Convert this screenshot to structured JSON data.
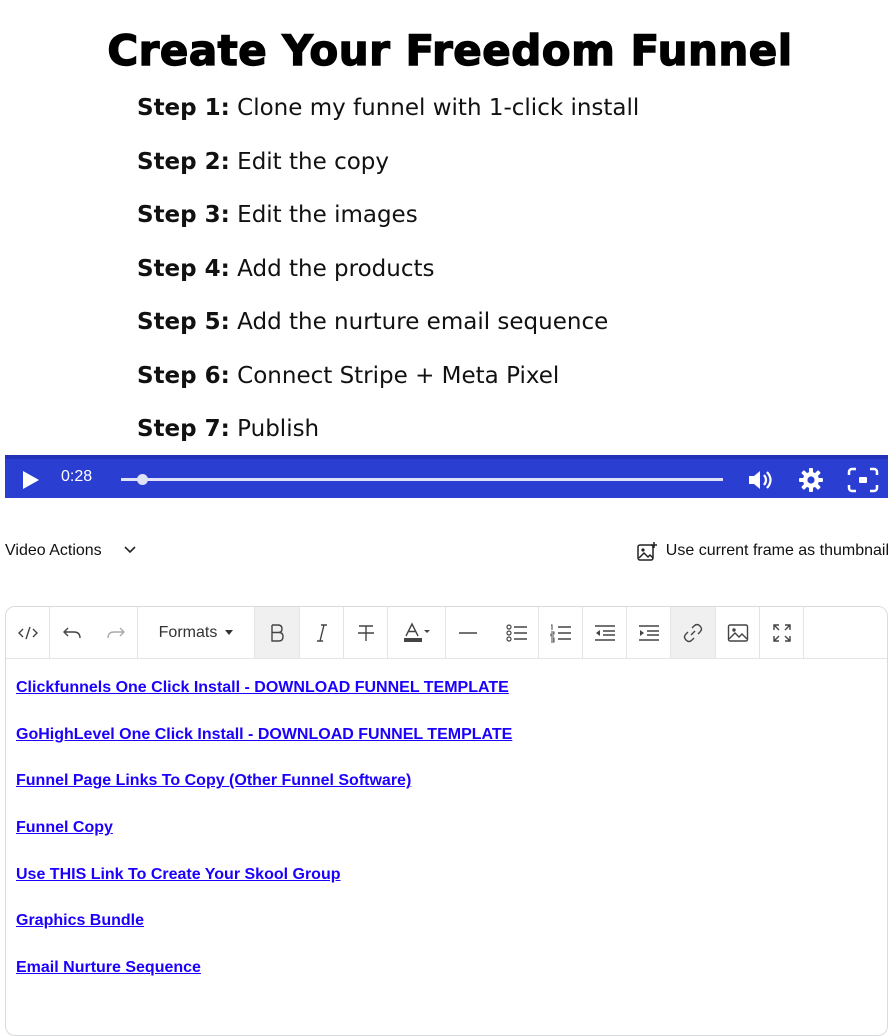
{
  "slide": {
    "title": "Create Your Freedom Funnel",
    "steps": [
      {
        "label": "Step 1:",
        "text": "Clone my funnel with 1-click install"
      },
      {
        "label": "Step 2:",
        "text": "Edit the copy"
      },
      {
        "label": "Step 3:",
        "text": "Edit the images"
      },
      {
        "label": "Step 4:",
        "text": "Add the products"
      },
      {
        "label": "Step 5:",
        "text": "Add the nurture email sequence"
      },
      {
        "label": "Step 6:",
        "text": "Connect Stripe + Meta Pixel"
      },
      {
        "label": "Step 7:",
        "text": "Publish"
      }
    ]
  },
  "player": {
    "time": "0:28",
    "progress": 0.035,
    "colors": {
      "bar": "#2a3fd2",
      "icon": "#ffffff"
    },
    "icons": [
      "play-icon",
      "volume-icon",
      "settings-gear-icon",
      "fullscreen-icon"
    ]
  },
  "actions": {
    "video_actions_label": "Video Actions",
    "thumbnail_label": "Use current frame as thumbnail"
  },
  "editor": {
    "formats_label": "Formats",
    "toolbar_icons": [
      "code-icon",
      "undo-icon",
      "redo-icon",
      "bold-icon",
      "italic-icon",
      "strikethrough-icon",
      "text-color-icon",
      "horizontal-rule-icon",
      "bullet-list-icon",
      "numbered-list-icon",
      "outdent-icon",
      "indent-icon",
      "link-icon",
      "image-icon",
      "fullscreen-icon"
    ],
    "link_color": "#1b00ff",
    "links": [
      "Clickfunnels One Click Install - DOWNLOAD FUNNEL TEMPLATE",
      "GoHighLevel One Click Install - DOWNLOAD FUNNEL TEMPLATE",
      "Funnel Page Links To Copy (Other Funnel Software)",
      "Funnel Copy",
      "Use THIS Link To Create Your Skool Group",
      "Graphics Bundle",
      "Email Nurture Sequence"
    ]
  }
}
